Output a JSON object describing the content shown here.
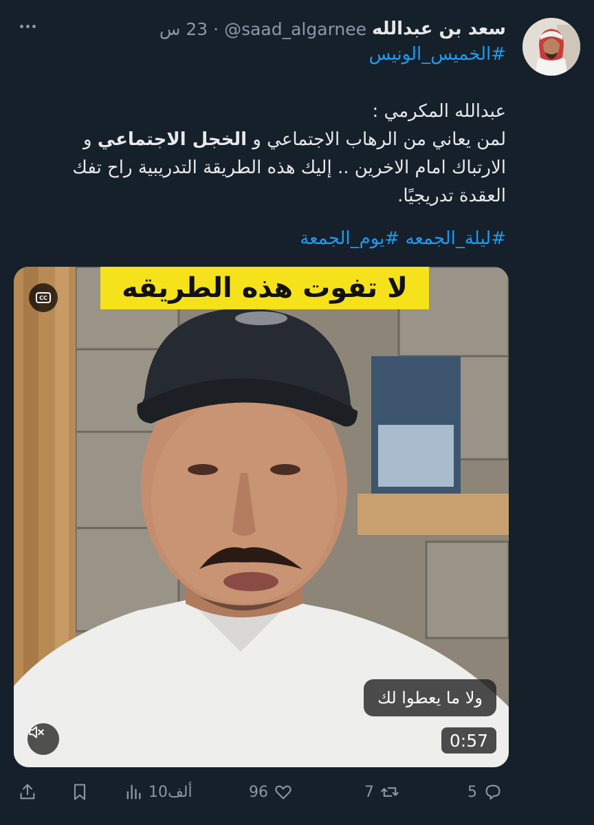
{
  "tweet": {
    "display_name": "سعد بن عبدالله",
    "handle": "@saad_algarnee",
    "separator": "·",
    "time": "23 س",
    "hashtag_top": "#الخميس_الونيس",
    "body": {
      "line1": "عبدالله المكرمي :",
      "line2_start": "لمن يعاني من الرهاب الاجتماعي و ",
      "line2_bold": "الخجل الاجتماعي",
      "line2_end": " و",
      "line3": "الارتباك امام الاخرين .. إليك هذه الطريقة التدريبية راح تفك",
      "line4": "العقدة تدريجيًا."
    },
    "hashtags_bottom": [
      "#ليلة_الجمعه",
      "#يوم_الجمعة"
    ]
  },
  "media": {
    "banner_text": "لا تفوت هذه الطريقه",
    "caption_text": "ولا ما يعطوا لك",
    "duration": "0:57",
    "cc_label": "CC"
  },
  "actions": {
    "replies": "5",
    "retweets": "7",
    "likes": "96",
    "views": "10ألف"
  },
  "colors": {
    "background": "#15202b",
    "text": "#e7e9ea",
    "muted": "#8b98a5",
    "link": "#1d9bf0",
    "banner": "#f5e21a"
  }
}
